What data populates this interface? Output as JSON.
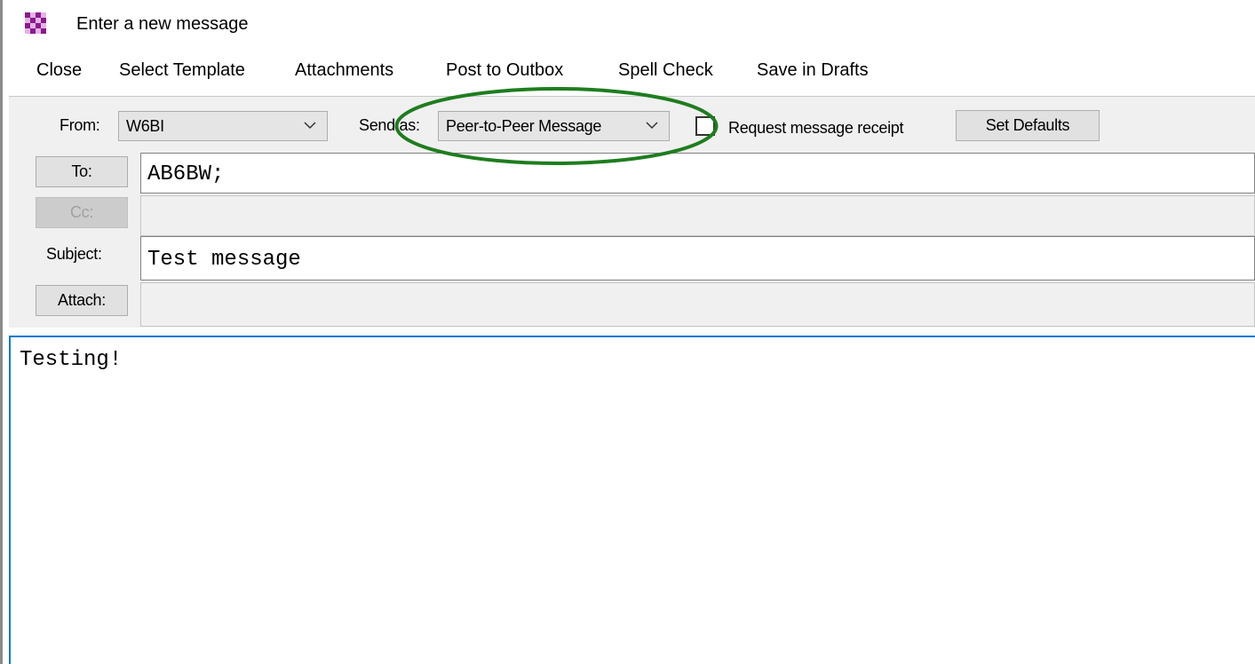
{
  "window": {
    "title": "Enter a new message",
    "icon": "checkerboard-app-icon",
    "accent_color": "#8b1a8f"
  },
  "menu": [
    {
      "id": "close",
      "label": "Close"
    },
    {
      "id": "select-template",
      "label": "Select Template"
    },
    {
      "id": "attachments",
      "label": "Attachments"
    },
    {
      "id": "post-to-outbox",
      "label": "Post to Outbox"
    },
    {
      "id": "spell-check",
      "label": "Spell Check"
    },
    {
      "id": "save-in-drafts",
      "label": "Save in Drafts"
    }
  ],
  "header": {
    "from_label": "From:",
    "from_value": "W6BI",
    "send_as_label": "Send as:",
    "send_as_value": "Peer-to-Peer Message",
    "receipt_label": "Request message receipt",
    "receipt_checked": false,
    "set_defaults_label": "Set Defaults",
    "to_button": "To:",
    "to_value": "AB6BW;",
    "cc_button": "Cc:",
    "cc_value": "",
    "subject_label": "Subject:",
    "subject_value": "Test message",
    "attach_button": "Attach:",
    "attach_value": ""
  },
  "body": {
    "text": "Testing!"
  },
  "annotation": {
    "color": "#1e7d1e",
    "shape": "ellipse around Send as dropdown"
  }
}
